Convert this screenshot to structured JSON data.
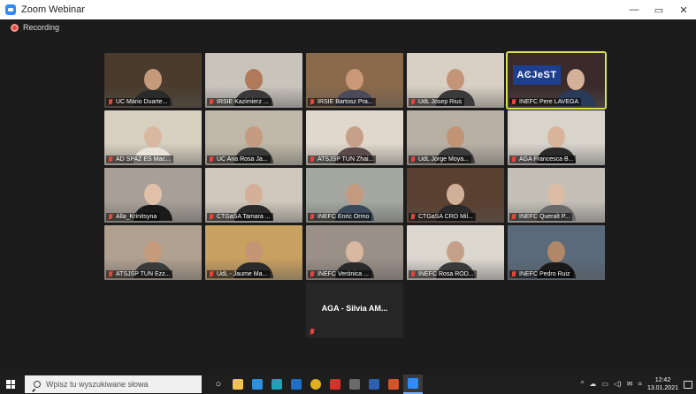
{
  "window": {
    "title": "Zoom Webinar",
    "minimize": "—",
    "maximize": "▭",
    "close": "✕"
  },
  "recording": {
    "label": "Recording",
    "color": "#e8453c"
  },
  "participants": [
    {
      "name": "UC Mário Duarte...",
      "bg": "#4a3b2c",
      "skin": "#c49a7a",
      "shirt": "#2a2a2a"
    },
    {
      "name": "IRSIE Kazimierz ...",
      "bg": "#c8c4bc",
      "skin": "#b07a5a",
      "shirt": "#3a3a3a"
    },
    {
      "name": "IRSIE Bartosz Pra...",
      "bg": "#8a6a4a",
      "skin": "#c89878",
      "shirt": "#4a4a5a"
    },
    {
      "name": "UdL Josep Rius",
      "bg": "#d8d0c4",
      "skin": "#c49478",
      "shirt": "#3a3a3a"
    },
    {
      "name": "INEFC Pere LAVEGA",
      "bg": "#3a2a2a",
      "skin": "#d4b098",
      "shirt": "#2a3a5a",
      "active": true,
      "logo": "AϾJeST"
    },
    {
      "name": "AD SPAZ ES Mac...",
      "bg": "#d8d0c0",
      "skin": "#d8b8a0",
      "shirt": "#e8e4dc"
    },
    {
      "name": "UC Ana Rosa Ja...",
      "bg": "#c0b8a8",
      "skin": "#c49a80",
      "shirt": "#3a3a3a"
    },
    {
      "name": "ATSJSP TUN Zhai...",
      "bg": "#e0d8cc",
      "skin": "#c4a088",
      "shirt": "#5a4a4a"
    },
    {
      "name": "UdL Jorge Moya...",
      "bg": "#b8b0a4",
      "skin": "#c09474",
      "shirt": "#3a3a3a"
    },
    {
      "name": "AGA Francesca B...",
      "bg": "#d8d4cc",
      "skin": "#d8b49a",
      "shirt": "#2a2a2a"
    },
    {
      "name": "Alla_Krinitsyna",
      "bg": "#a8a098",
      "skin": "#e0c0a8",
      "shirt": "#1a1a1a"
    },
    {
      "name": "CTGaSA Tamara ...",
      "bg": "#d0c8bc",
      "skin": "#d4b098",
      "shirt": "#2a2a2a"
    },
    {
      "name": "INEFC Enric Ormo",
      "bg": "#a4a8a0",
      "skin": "#c49a80",
      "shirt": "#3a4a5a"
    },
    {
      "name": "CTGaSA CRO Mil...",
      "bg": "#5a4030",
      "skin": "#d0b098",
      "shirt": "#2a2a2a"
    },
    {
      "name": "INEFC Queralt P...",
      "bg": "#c4c0b8",
      "skin": "#dcbca4",
      "shirt": "#6a6a6a"
    },
    {
      "name": "ATSJSP TUN Ezz...",
      "bg": "#b0a090",
      "skin": "#c49a7a",
      "shirt": "#3a3a3a"
    },
    {
      "name": "UdL - Jaume Ma...",
      "bg": "#c8a060",
      "skin": "#c49474",
      "shirt": "#2a2a2a"
    },
    {
      "name": "INEFC Verónica ...",
      "bg": "#9a9088",
      "skin": "#d8b8a0",
      "shirt": "#2a2a2a"
    },
    {
      "name": "INEFC Rosa ROD...",
      "bg": "#dcd8d0",
      "skin": "#c4a088",
      "shirt": "#3a3a3a"
    },
    {
      "name": "INEFC Pedro Ruiz",
      "bg": "#5a6a7a",
      "skin": "#b08868",
      "shirt": "#1a1a1a"
    },
    {
      "name": "AGA - Silvia AM...",
      "bg": "#262626",
      "video_off": true
    }
  ],
  "taskbar": {
    "search_placeholder": "Wpisz tu wyszukiwane słowa",
    "apps": [
      {
        "name": "task-view",
        "glyph": "○",
        "color": "#ffffff"
      },
      {
        "name": "file-explorer",
        "glyph": "",
        "color": "#f2c24e"
      },
      {
        "name": "edge",
        "glyph": "",
        "color": "#2f8fdc"
      },
      {
        "name": "store",
        "glyph": "",
        "color": "#1fa2b8"
      },
      {
        "name": "outlook",
        "glyph": "",
        "color": "#1f6fc8"
      },
      {
        "name": "chrome",
        "glyph": "",
        "color": "#e0b020"
      },
      {
        "name": "acrobat",
        "glyph": "",
        "color": "#d8302a"
      },
      {
        "name": "calculator",
        "glyph": "",
        "color": "#6a6a6a"
      },
      {
        "name": "word",
        "glyph": "",
        "color": "#2b5fb0"
      },
      {
        "name": "powerpoint",
        "glyph": "",
        "color": "#d4542a"
      },
      {
        "name": "zoom",
        "glyph": "",
        "color": "#2d8cff",
        "active": true
      }
    ],
    "tray_symbols": [
      "^",
      "☁",
      "▭",
      "◁)",
      "✉",
      "⌗"
    ],
    "time": "12:42",
    "date": "13.01.2021"
  }
}
